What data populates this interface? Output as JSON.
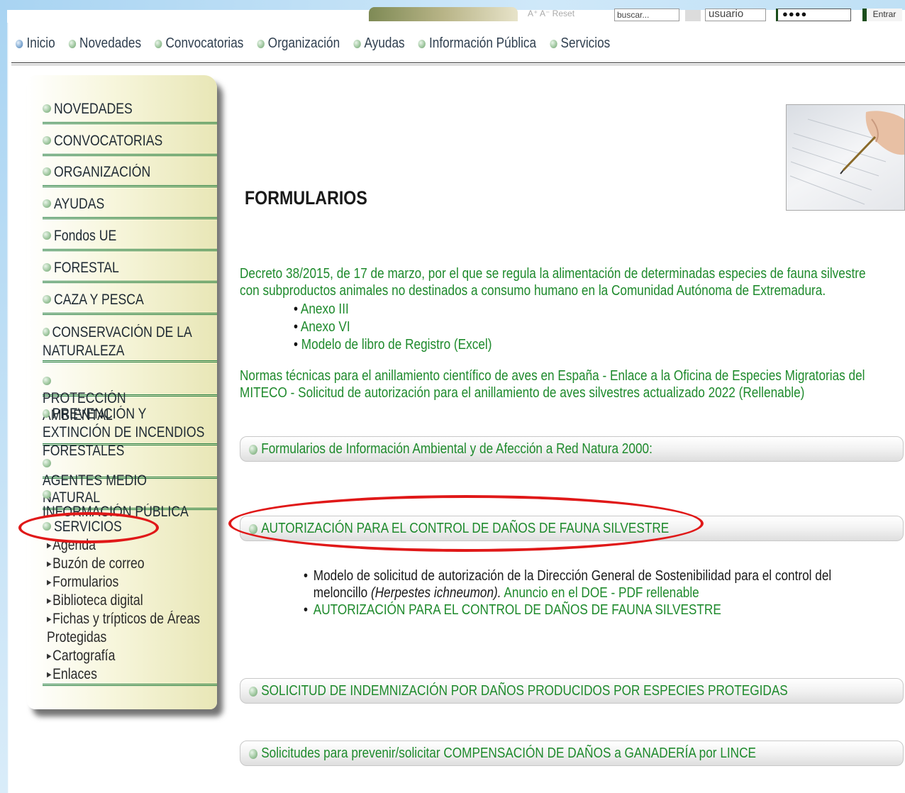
{
  "header": {
    "accessibility": "A⁺ A⁻ Reset",
    "search_placeholder": "buscar...",
    "user_placeholder": "usuario",
    "password_mask": "●●●●",
    "enter_label": "Entrar"
  },
  "topnav": [
    "Inicio",
    "Novedades",
    "Convocatorias",
    "Organización",
    "Ayudas",
    "Información Pública",
    "Servicios"
  ],
  "sidebar": {
    "items": [
      "NOVEDADES",
      "CONVOCATORIAS",
      "ORGANIZACIÓN",
      "AYUDAS",
      "Fondos UE",
      "FORESTAL",
      "CAZA Y PESCA",
      "CONSERVACIÓN DE LA NATURALEZA",
      "PROTECCIÓN AMBIENTAL",
      "PREVENCIÓN Y EXTINCIÓN DE INCENDIOS FORESTALES",
      "AGENTES MEDIO NATURAL",
      "INFORMACIÓN PÚBLICA",
      "SERVICIOS"
    ],
    "subitems": [
      "Agenda",
      "Buzón de correo",
      "Formularios",
      "Biblioteca digital",
      "Fichas y trípticos de Áreas",
      "Protegidas",
      "Cartografía",
      "Enlaces"
    ]
  },
  "main": {
    "title": "FORMULARIOS",
    "decree_1": "Decreto 38/2015, de 17 de marzo, por el que se regula la alimentación de determinadas especies de fauna silvestre",
    "decree_2": "con subproductos animales no destinados a consumo humano en la Comunidad Autónoma de Extremadura.",
    "annexes": [
      "Anexo III",
      "Anexo VI",
      "Modelo de libro de Registro (Excel)"
    ],
    "norms_1": "Normas técnicas para el anillamiento científico de aves en España - Enlace a la Oficina de Especies Migratorias del",
    "norms_2": "MITECO - Solicitud de autorización para el anillamiento de aves silvestres actualizado 2022 (Rellenable)",
    "sections": [
      "Formularios de Información Ambiental y de Afección a Red Natura 2000:",
      "AUTORIZACIÓN PARA EL CONTROL DE DAÑOS DE FAUNA SILVESTRE",
      "SOLICITUD DE INDEMNIZACIÓN POR DAÑOS PRODUCIDOS POR ESPECIES PROTEGIDAS",
      "Solicitudes para prevenir/solicitar COMPENSACIÓN DE DAÑOS a GANADERÍA por LINCE"
    ],
    "sub_list": {
      "item1_a": "Modelo de solicitud de autorización de la Dirección General de Sostenibilidad para el control del",
      "item1_b": "meloncillo ",
      "item1_c": "(Herpestes ichneumon).",
      "item1_d": " Anuncio en el DOE - PDF rellenable",
      "item2": "AUTORIZACIÓN PARA EL CONTROL DE DAÑOS DE FAUNA SILVESTRE"
    }
  },
  "colors": {
    "link_green": "#1e8a2c",
    "highlight_red": "#e01818"
  }
}
